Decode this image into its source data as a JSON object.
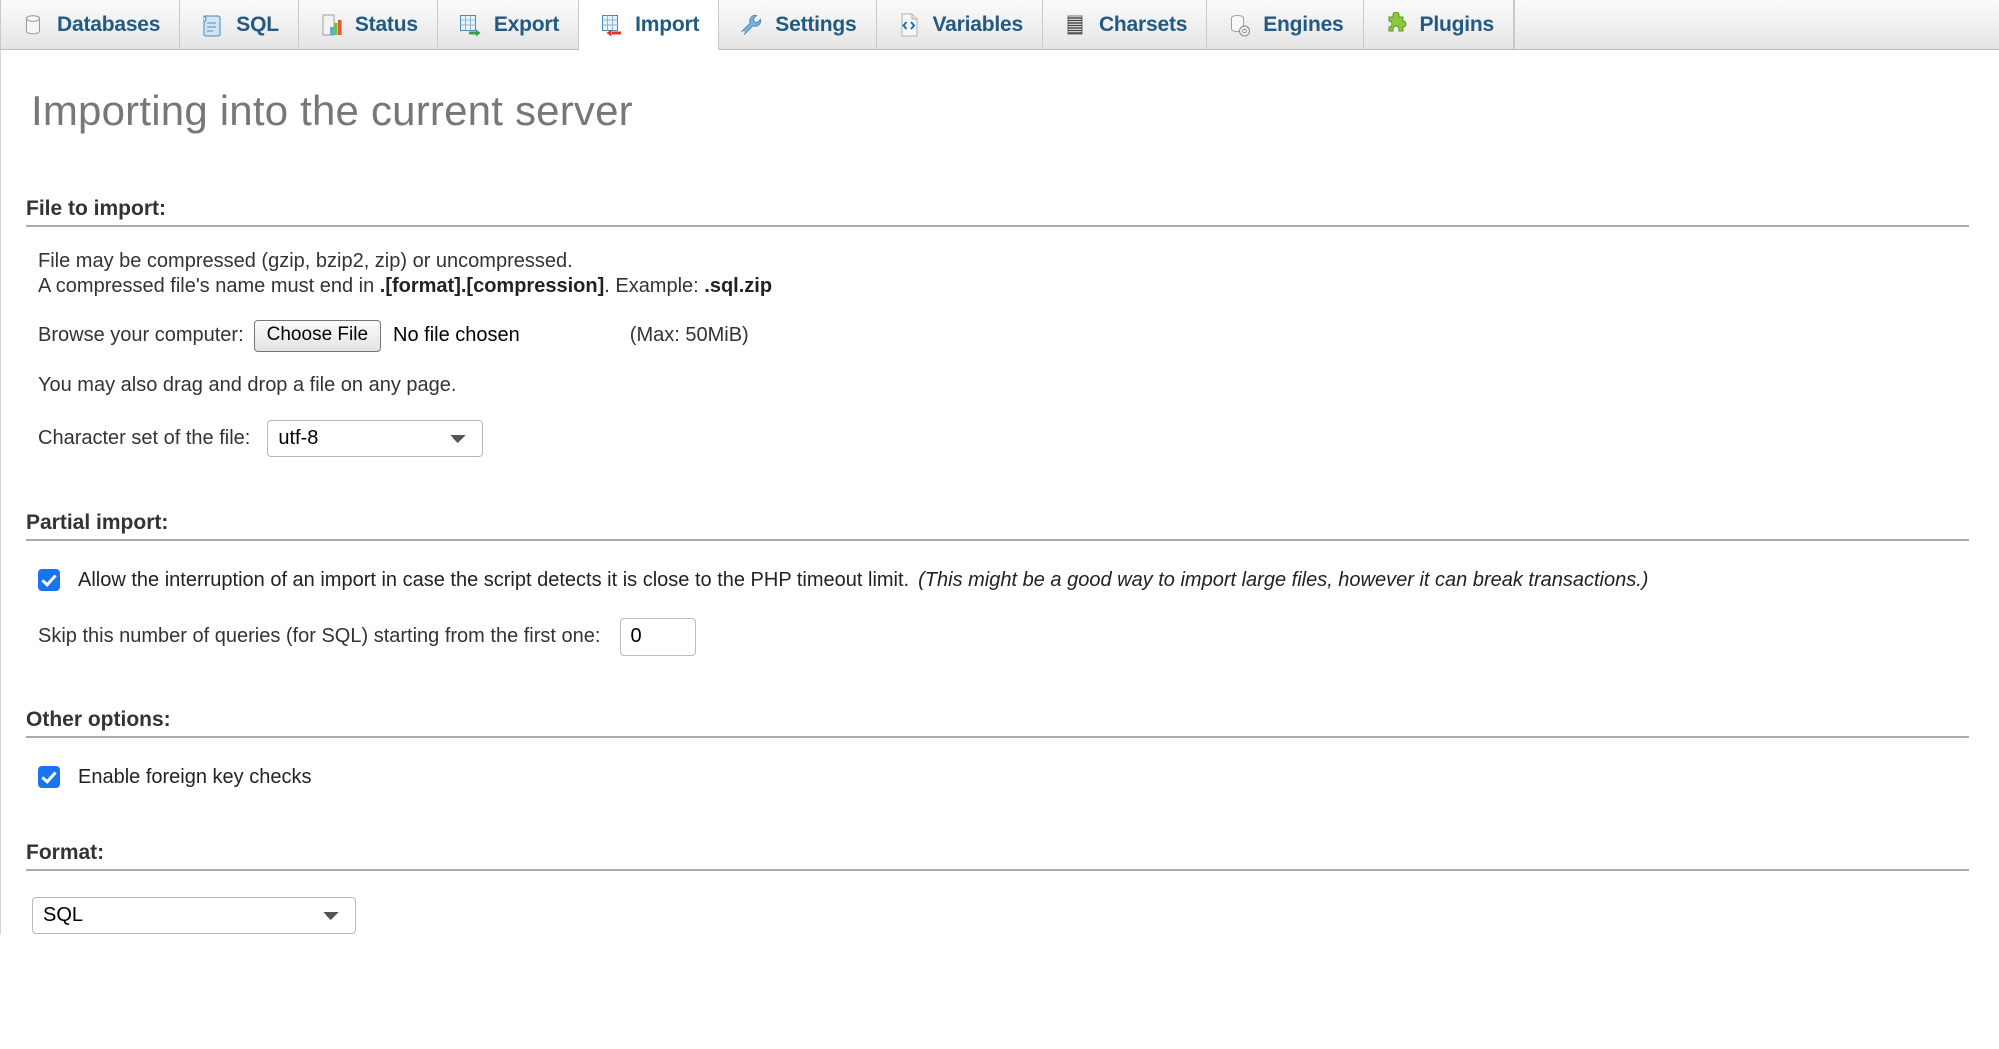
{
  "tabs": [
    {
      "label": "Databases",
      "icon": "database-icon",
      "active": false
    },
    {
      "label": "SQL",
      "icon": "sql-scroll-icon",
      "active": false
    },
    {
      "label": "Status",
      "icon": "status-chart-icon",
      "active": false
    },
    {
      "label": "Export",
      "icon": "export-icon",
      "active": false
    },
    {
      "label": "Import",
      "icon": "import-icon",
      "active": true
    },
    {
      "label": "Settings",
      "icon": "wrench-icon",
      "active": false
    },
    {
      "label": "Variables",
      "icon": "code-file-icon",
      "active": false
    },
    {
      "label": "Charsets",
      "icon": "charsets-icon",
      "active": false
    },
    {
      "label": "Engines",
      "icon": "engines-icon",
      "active": false
    },
    {
      "label": "Plugins",
      "icon": "plugins-icon",
      "active": false
    }
  ],
  "page": {
    "title": "Importing into the current server"
  },
  "file_section": {
    "heading": "File to import:",
    "desc_line1": "File may be compressed (gzip, bzip2, zip) or uncompressed.",
    "desc_line2_pre": "A compressed file's name must end in ",
    "desc_line2_bold": ".[format].[compression]",
    "desc_line2_mid": ". Example: ",
    "desc_line2_bold2": ".sql.zip",
    "browse_label": "Browse your computer:",
    "choose_file_button": "Choose File",
    "no_file_chosen": "No file chosen",
    "max_size": "(Max: 50MiB)",
    "dragdrop_note": "You may also drag and drop a file on any page.",
    "charset_label": "Character set of the file:",
    "charset_value": "utf-8",
    "charset_options": [
      "utf-8"
    ]
  },
  "partial_section": {
    "heading": "Partial import:",
    "allow_interrupt_checked": true,
    "allow_interrupt_label": "Allow the interruption of an import in case the script detects it is close to the PHP timeout limit.",
    "allow_interrupt_note": "(This might be a good way to import large files, however it can break transactions.)",
    "skip_label": "Skip this number of queries (for SQL) starting from the first one:",
    "skip_value": "0"
  },
  "other_section": {
    "heading": "Other options:",
    "fk_checked": true,
    "fk_label": "Enable foreign key checks"
  },
  "format_section": {
    "heading": "Format:",
    "format_value": "SQL",
    "format_options": [
      "SQL"
    ]
  },
  "colors": {
    "tab_text": "#235a81",
    "title_text": "#777777",
    "checkbox_accent": "#1a73f0",
    "rule": "#aaaaaa"
  }
}
